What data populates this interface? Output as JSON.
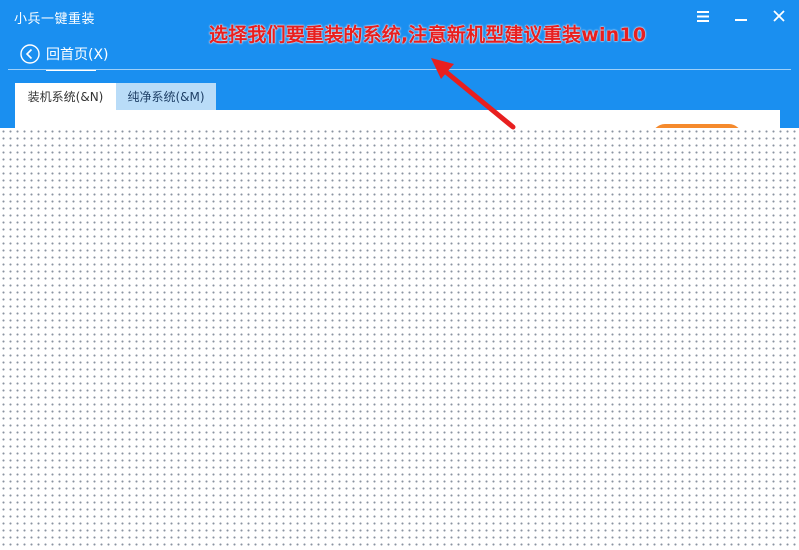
{
  "window": {
    "title": "小兵一键重装",
    "controls": [
      "menu-icon",
      "minimize-icon",
      "close-icon"
    ]
  },
  "annotation": {
    "text": "选择我们要重装的系统,注意新机型建议重装win10",
    "color": "#e81f1f"
  },
  "nav": {
    "back_label": "回首页(X)",
    "back_icon": "arrow-left-circle-icon"
  },
  "tabs": [
    {
      "label": "装机系统(&N)",
      "active": true
    },
    {
      "label": "纯净系统(&M)",
      "active": false
    }
  ],
  "colors": {
    "primary": "#1a8ff0",
    "accent": "#f58a2d",
    "tab_inactive": "#b9dcf8"
  }
}
